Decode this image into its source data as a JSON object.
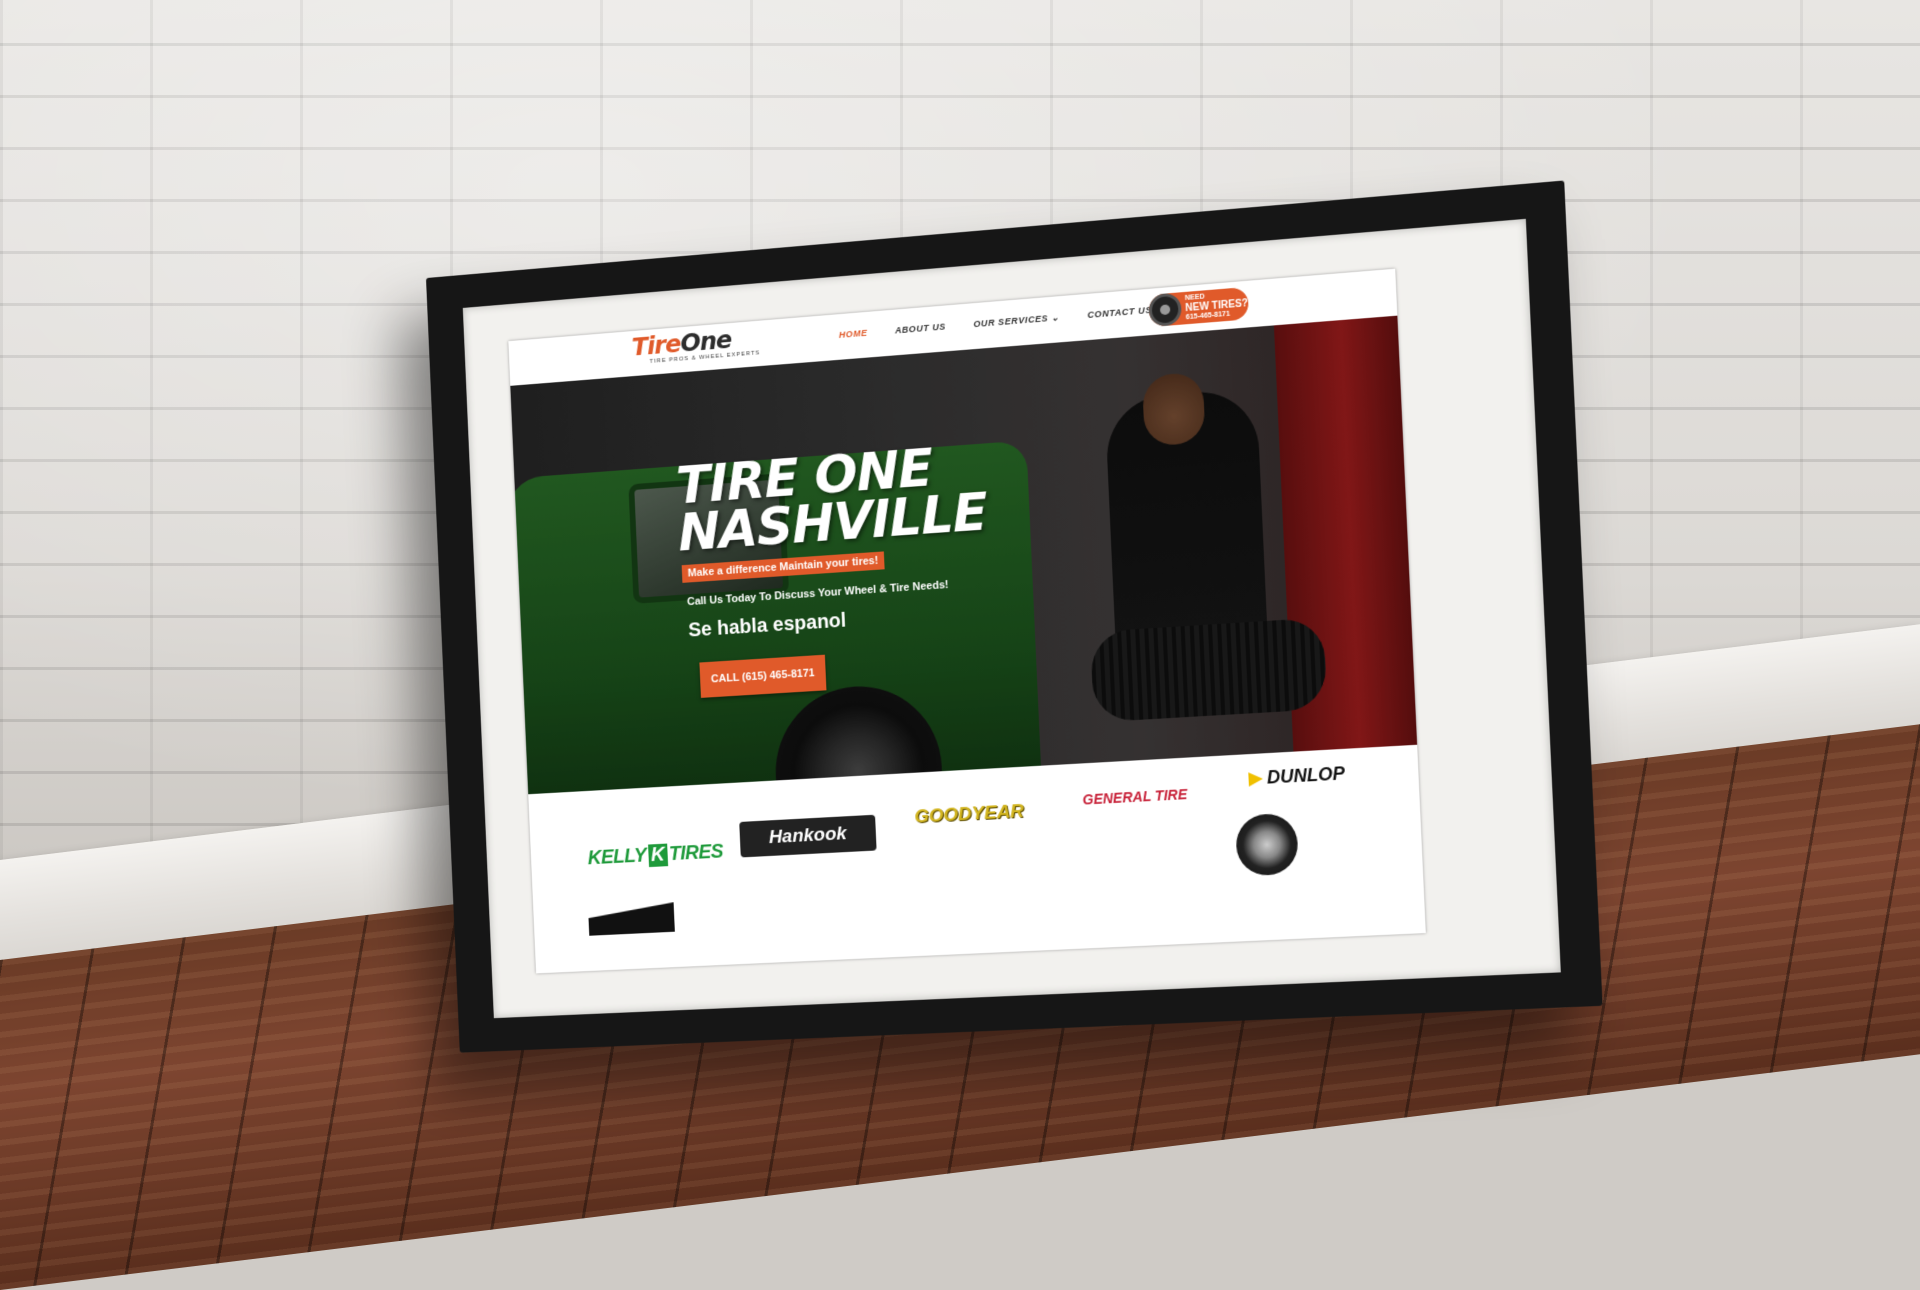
{
  "header": {
    "logo_word_a": "Tire",
    "logo_word_b": "One",
    "logo_tagline": "TIRE PROS & WHEEL EXPERTS",
    "nav": [
      {
        "label": "HOME",
        "active": true
      },
      {
        "label": "ABOUT US",
        "active": false
      },
      {
        "label": "OUR SERVICES ⌄",
        "active": false
      },
      {
        "label": "CONTACT US",
        "active": false
      }
    ],
    "cta": {
      "line1": "NEED",
      "line2": "NEW TIRES?",
      "phone": "615-465-8171"
    }
  },
  "hero": {
    "title_line1": "TIRE ONE",
    "title_line2": "NASHVILLE",
    "tagline": "Make a difference Maintain your tires!",
    "subtitle": "Call Us Today To Discuss Your Wheel & Tire Needs!",
    "spanish": "Se habla espanol",
    "button_label": "CALL (615) 465-8171"
  },
  "brands": {
    "kelly_a": "KELLY",
    "kelly_k": "K",
    "kelly_b": "TIRES",
    "hankook": "Hankook",
    "goodyear": "GOODYEAR",
    "general": "GENERAL TIRE",
    "dunlop": "DUNLOP"
  },
  "colors": {
    "brand_orange": "#e05a2a",
    "kelly_green": "#1e9a3a",
    "goodyear_gold": "#d2b520",
    "general_red": "#c8233a"
  }
}
